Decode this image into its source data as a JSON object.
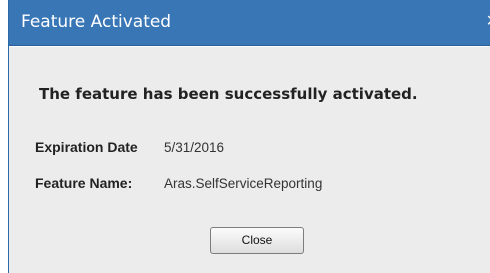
{
  "dialog": {
    "title": "Feature Activated",
    "close_icon": "×",
    "message": "The feature has been successfully activated.",
    "fields": [
      {
        "label": "Expiration Date",
        "value": "5/31/2016"
      },
      {
        "label": "Feature Name:",
        "value": "Aras.SelfServiceReporting"
      }
    ],
    "close_button_label": "Close"
  },
  "colors": {
    "titlebar": "#3876b6",
    "body": "#ececec",
    "text": "#222222"
  }
}
